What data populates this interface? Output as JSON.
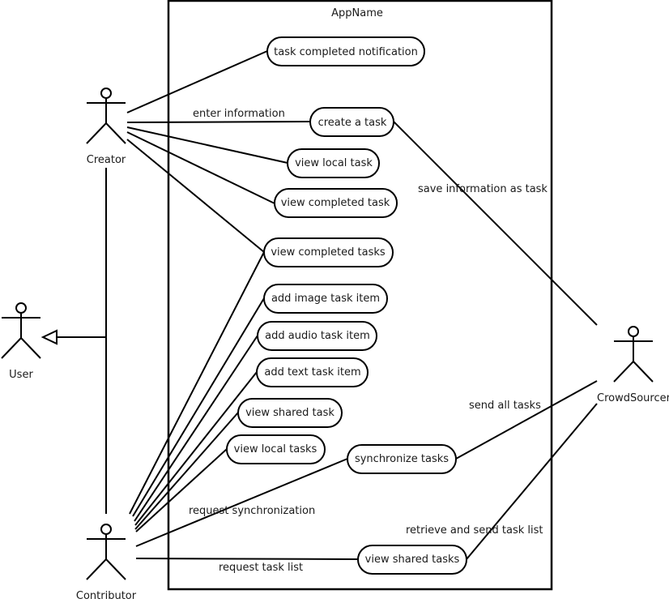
{
  "system": {
    "name": "AppName"
  },
  "actors": [
    {
      "id": "creator",
      "label": "Creator"
    },
    {
      "id": "user",
      "label": "User"
    },
    {
      "id": "contributor",
      "label": "Contributor"
    },
    {
      "id": "crowdsourcer",
      "label": "CrowdSourcer"
    }
  ],
  "use_cases": [
    {
      "id": "uc1",
      "label": "task completed notification"
    },
    {
      "id": "uc2",
      "label": "create a task"
    },
    {
      "id": "uc3",
      "label": "view local task"
    },
    {
      "id": "uc4",
      "label": "view completed task"
    },
    {
      "id": "uc5",
      "label": "view completed tasks"
    },
    {
      "id": "uc6",
      "label": "add image task item"
    },
    {
      "id": "uc7",
      "label": "add audio task item"
    },
    {
      "id": "uc8",
      "label": "add text task item"
    },
    {
      "id": "uc9",
      "label": "view shared task"
    },
    {
      "id": "uc10",
      "label": "view local tasks"
    },
    {
      "id": "uc11",
      "label": "synchronize tasks"
    },
    {
      "id": "uc12",
      "label": "view shared tasks"
    }
  ],
  "associations": [
    {
      "from": "creator",
      "to": "uc1",
      "label": ""
    },
    {
      "from": "creator",
      "to": "uc2",
      "label": "enter information"
    },
    {
      "from": "creator",
      "to": "uc3",
      "label": ""
    },
    {
      "from": "creator",
      "to": "uc4",
      "label": ""
    },
    {
      "from": "creator",
      "to": "uc5",
      "label": ""
    },
    {
      "from": "uc2",
      "to": "crowdsourcer",
      "label": "save information as task"
    },
    {
      "from": "contributor",
      "to": "uc5",
      "label": ""
    },
    {
      "from": "contributor",
      "to": "uc6",
      "label": ""
    },
    {
      "from": "contributor",
      "to": "uc7",
      "label": ""
    },
    {
      "from": "contributor",
      "to": "uc8",
      "label": ""
    },
    {
      "from": "contributor",
      "to": "uc9",
      "label": ""
    },
    {
      "from": "contributor",
      "to": "uc10",
      "label": ""
    },
    {
      "from": "contributor",
      "to": "uc11",
      "label": "request synchronization"
    },
    {
      "from": "uc11",
      "to": "crowdsourcer",
      "label": "send all tasks"
    },
    {
      "from": "contributor",
      "to": "uc12",
      "label": "request task list"
    },
    {
      "from": "uc12",
      "to": "crowdsourcer",
      "label": "retrieve and send task list"
    }
  ],
  "generalizations": [
    {
      "children": [
        "creator",
        "contributor"
      ],
      "parent": "user"
    }
  ],
  "labels": {
    "enter_information": "enter information",
    "save_information_as_task": "save information as task",
    "send_all_tasks": "send all tasks",
    "request_synchronization": "request synchronization",
    "retrieve_and_send_task_list": "retrieve and send task list",
    "request_task_list": "request task list"
  }
}
